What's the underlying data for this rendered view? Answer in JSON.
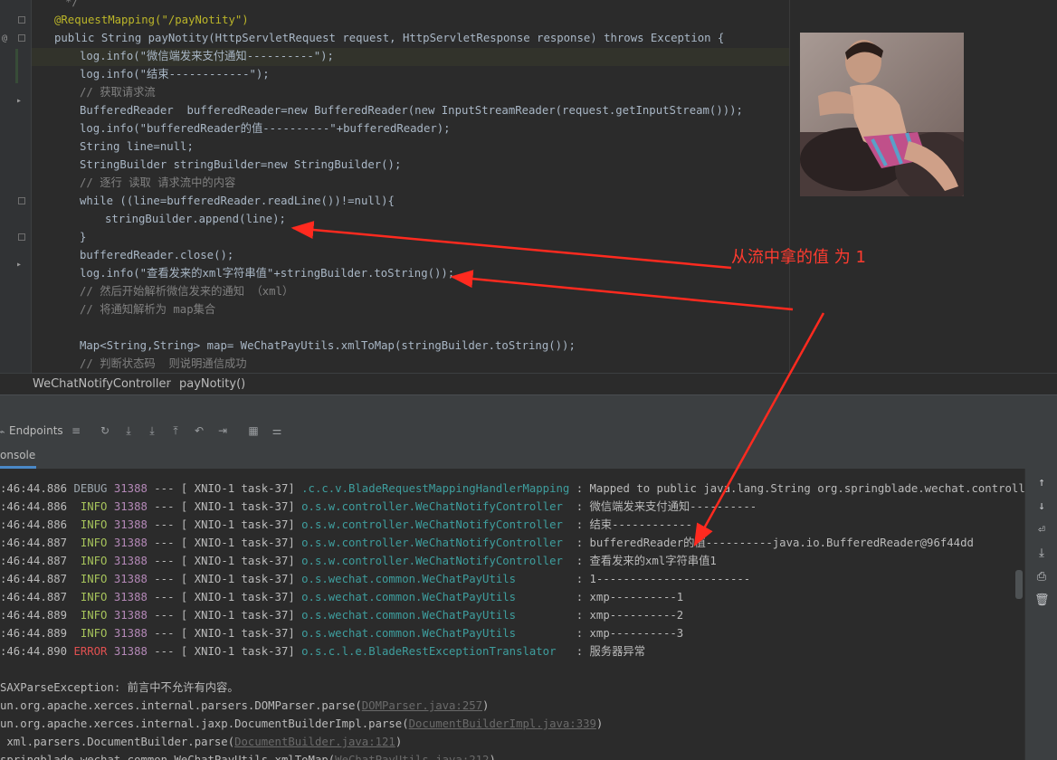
{
  "editor": {
    "lines": [
      {
        "text": "*/"
      },
      {
        "text": "@RequestMapping(\"/payNotity\")"
      },
      {
        "text": "public String payNotity(HttpServletRequest request, HttpServletResponse response) throws Exception {"
      },
      {
        "text": "log.info(\"微信端发来支付通知----------\");"
      },
      {
        "text": "log.info(\"结束------------\");"
      },
      {
        "text": "// 获取请求流"
      },
      {
        "text": "BufferedReader  bufferedReader=new BufferedReader(new InputStreamReader(request.getInputStream()));"
      },
      {
        "text": "log.info(\"bufferedReader的值----------\"+bufferedReader);"
      },
      {
        "text": "String line=null;"
      },
      {
        "text": "StringBuilder stringBuilder=new StringBuilder();"
      },
      {
        "text": "// 逐行 读取 请求流中的内容"
      },
      {
        "text": "while ((line=bufferedReader.readLine())!=null){"
      },
      {
        "text": "stringBuilder.append(line);"
      },
      {
        "text": "}"
      },
      {
        "text": "bufferedReader.close();"
      },
      {
        "text": "log.info(\"查看发来的xml字符串值\"+stringBuilder.toString());"
      },
      {
        "text": "// 然后开始解析微信发来的通知 （xml）"
      },
      {
        "text": "// 将通知解析为 map集合"
      },
      {
        "text": "Map<String,String> map= WeChatPayUtils.xmlToMap(stringBuilder.toString());"
      },
      {
        "text": "// 判断状态码  则说明通信成功"
      }
    ],
    "gutter_at": "@"
  },
  "breadcrumb": {
    "class_name": "WeChatNotifyController",
    "separator": "›",
    "method_name": "payNotity()"
  },
  "toolbar": {
    "endpoints_label": "Endpoints"
  },
  "tabs": {
    "console_label": "onsole"
  },
  "annotation": {
    "text": "从流中拿的值 为  1",
    "color": "#ff3b2f"
  },
  "console": {
    "log_lines": [
      {
        "time": ":46:44.886",
        "level": "DEBUG",
        "pid": "31388",
        "sep": "--- [ XNIO-1 task-37]",
        "logger": ".c.c.v.BladeRequestMappingHandlerMapping",
        "msg": " : Mapped to public java.lang.String org.springblade.wechat.controller.WeCha"
      },
      {
        "time": ":46:44.886",
        "level": " INFO",
        "pid": "31388",
        "sep": "--- [ XNIO-1 task-37]",
        "logger": "o.s.w.controller.WeChatNotifyController ",
        "msg": " : 微信端发来支付通知----------"
      },
      {
        "time": ":46:44.886",
        "level": " INFO",
        "pid": "31388",
        "sep": "--- [ XNIO-1 task-37]",
        "logger": "o.s.w.controller.WeChatNotifyController ",
        "msg": " : 结束------------"
      },
      {
        "time": ":46:44.887",
        "level": " INFO",
        "pid": "31388",
        "sep": "--- [ XNIO-1 task-37]",
        "logger": "o.s.w.controller.WeChatNotifyController ",
        "msg": " : bufferedReader的值----------java.io.BufferedReader@96f44dd"
      },
      {
        "time": ":46:44.887",
        "level": " INFO",
        "pid": "31388",
        "sep": "--- [ XNIO-1 task-37]",
        "logger": "o.s.w.controller.WeChatNotifyController ",
        "msg": " : 查看发来的xml字符串值1"
      },
      {
        "time": ":46:44.887",
        "level": " INFO",
        "pid": "31388",
        "sep": "--- [ XNIO-1 task-37]",
        "logger": "o.s.wechat.common.WeChatPayUtils        ",
        "msg": " : 1-----------------------"
      },
      {
        "time": ":46:44.887",
        "level": " INFO",
        "pid": "31388",
        "sep": "--- [ XNIO-1 task-37]",
        "logger": "o.s.wechat.common.WeChatPayUtils        ",
        "msg": " : xmp----------1"
      },
      {
        "time": ":46:44.889",
        "level": " INFO",
        "pid": "31388",
        "sep": "--- [ XNIO-1 task-37]",
        "logger": "o.s.wechat.common.WeChatPayUtils        ",
        "msg": " : xmp----------2"
      },
      {
        "time": ":46:44.889",
        "level": " INFO",
        "pid": "31388",
        "sep": "--- [ XNIO-1 task-37]",
        "logger": "o.s.wechat.common.WeChatPayUtils        ",
        "msg": " : xmp----------3"
      },
      {
        "time": ":46:44.890",
        "level": "ERROR",
        "pid": "31388",
        "sep": "--- [ XNIO-1 task-37]",
        "logger": "o.s.c.l.e.BladeRestExceptionTranslator  ",
        "msg": " : 服务器异常"
      }
    ],
    "exception": "SAXParseException: 前言中不允许有内容。",
    "stack": [
      {
        "prefix": "un.org.apache.xerces.internal.parsers.DOMParser.parse(",
        "link": "DOMParser.java:257",
        "suffix": ")"
      },
      {
        "prefix": "un.org.apache.xerces.internal.jaxp.DocumentBuilderImpl.parse(",
        "link": "DocumentBuilderImpl.java:339",
        "suffix": ")"
      },
      {
        "prefix": " xml.parsers.DocumentBuilder.parse(",
        "link": "DocumentBuilder.java:121",
        "suffix": ")"
      },
      {
        "prefix": "springblade.wechat.common.WeChatPayUtils.xmlToMap(",
        "link": "WeChatPayUtils.java:212",
        "suffix": ")"
      }
    ]
  }
}
